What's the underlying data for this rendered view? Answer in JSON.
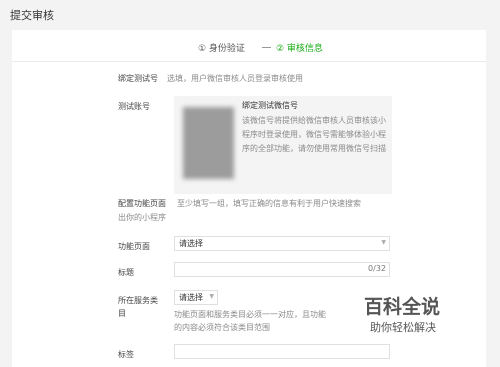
{
  "header": {
    "title": "提交审核"
  },
  "steps": [
    {
      "label": "① 身份验证"
    },
    {
      "label": "② 审核信息"
    }
  ],
  "bind_wechat": {
    "label": "绑定测试号",
    "hint": "选填，用户微信审核人员登录审核使用",
    "account_label": "测试账号",
    "box_title": "绑定测试微信号",
    "box_desc": "该微信号将提供给微信审核人员审核该小程序时登录使用，微信号需能够体验小程序的全部功能，请勿使用常用微信号扫描"
  },
  "config": {
    "label": "配置功能页面",
    "hint_line1": "至少填写一组，填写正确的信息有利于用户快速搜索",
    "hint_line2": "出你的小程序",
    "page_label": "功能页面",
    "page_value": "请选择",
    "title_label": "标题",
    "title_counter": "0/32",
    "category_label_line1": "所在服务类",
    "category_label_line2": "目",
    "category_value": "请选择",
    "category_hint_line1": "功能页面和服务类目必须一一对应，且功能",
    "category_hint_line2": "的内容必须符合该类目范围",
    "tag_label": "标签"
  },
  "watermark": {
    "line1": "百科全说",
    "line2": "助你轻松解决"
  },
  "colors": {
    "accent": "#1aad19",
    "background": "#f3f3f3"
  }
}
